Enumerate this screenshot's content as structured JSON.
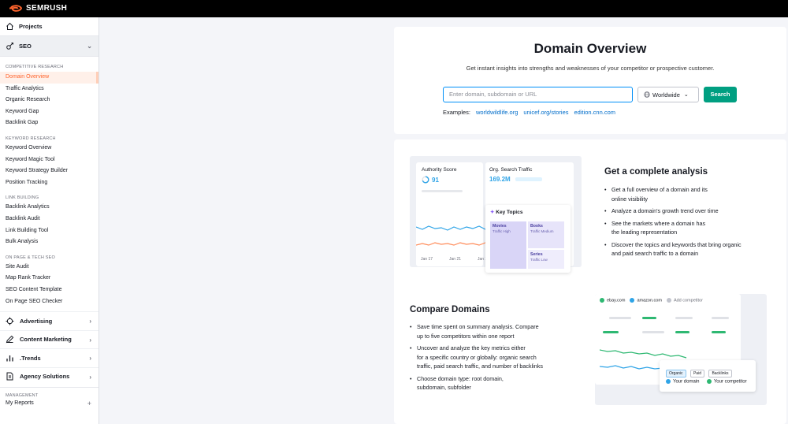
{
  "brand": {
    "name": "SEMRUSH",
    "accent": "#ff642d"
  },
  "sidebar": {
    "projects_label": "Projects",
    "seo_label": "SEO",
    "sections": [
      {
        "title": "COMPETITIVE RESEARCH",
        "items": [
          "Domain Overview",
          "Traffic Analytics",
          "Organic Research",
          "Keyword Gap",
          "Backlink Gap"
        ]
      },
      {
        "title": "KEYWORD RESEARCH",
        "items": [
          "Keyword Overview",
          "Keyword Magic Tool",
          "Keyword Strategy Builder",
          "Position Tracking"
        ]
      },
      {
        "title": "LINK BUILDING",
        "items": [
          "Backlink Analytics",
          "Backlink Audit",
          "Link Building Tool",
          "Bulk Analysis"
        ]
      },
      {
        "title": "ON PAGE & TECH SEO",
        "items": [
          "Site Audit",
          "Map Rank Tracker",
          "SEO Content Template",
          "On Page SEO Checker"
        ]
      }
    ],
    "groups": [
      "Advertising",
      "Content Marketing",
      ".Trends",
      "Agency Solutions"
    ],
    "management_title": "MANAGEMENT",
    "my_reports": "My Reports",
    "plus": "+"
  },
  "overview": {
    "title": "Domain Overview",
    "subtitle": "Get instant insights into strengths and weaknesses of your competitor or prospective customer.",
    "search_placeholder": "Enter domain, subdomain or URL",
    "region": "Worldwide",
    "search_button": "Search",
    "examples_label": "Examples:",
    "examples": [
      "worldwildlife.org",
      "unicef.org/stories",
      "edition.cnn.com"
    ]
  },
  "analysis": {
    "title": "Get a complete analysis",
    "bullets": [
      "Get a full overview of a domain and its\nonline visibility",
      "Analyze a domain's growth trend over time",
      "See the markets where a domain has\nthe leading representation",
      "Discover the topics and keywords that bring organic\nand paid search traffic to a domain"
    ],
    "illustration": {
      "authority_label": "Authority Score",
      "authority_value": "91",
      "org_traffic_label": "Org. Search Traffic",
      "org_traffic_value": "169.2M",
      "key_topics_label": "Key Topics",
      "topics": [
        {
          "name": "Movies",
          "level": "Traffic High"
        },
        {
          "name": "Books",
          "level": "Traffic Medium"
        },
        {
          "name": "Series",
          "level": "Traffic Low"
        }
      ],
      "x_labels": [
        "Jan 17",
        "Jan 21",
        "Jan 25"
      ]
    }
  },
  "compare": {
    "title": "Compare Domains",
    "bullets": [
      "Save time spent on summary analysis. Compare\nup to five competitors within one report",
      "Uncover and analyze the key metrics either\nfor a specific country or globally: organic search\ntraffic, paid search traffic, and number of backlinks",
      "Choose domain type: root domain,\nsubdomain, subfolder"
    ],
    "illustration": {
      "domains": [
        "ebay.com",
        "amazon.com",
        "Add competitor"
      ],
      "tabs": [
        "Organic",
        "Paid",
        "Backlinks"
      ],
      "legend_yours": "Your domain",
      "legend_competitor": "Your competitor"
    }
  },
  "colors": {
    "primary_button": "#009f81",
    "link": "#006dca",
    "input_focus": "#008ff8",
    "active_item_bg": "#fff0e9"
  }
}
